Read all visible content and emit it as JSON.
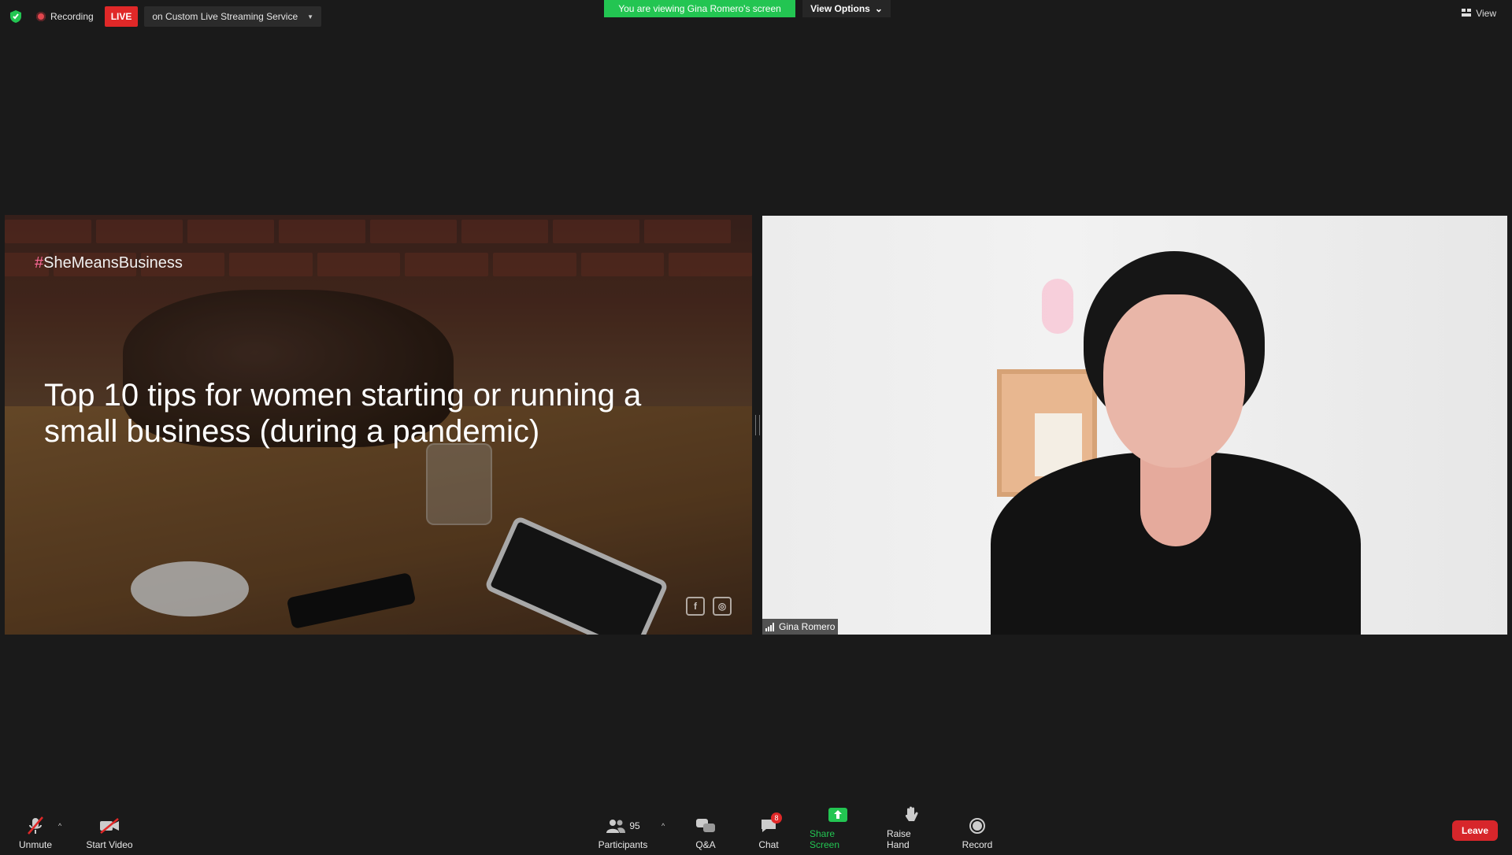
{
  "topbar": {
    "recording_label": "Recording",
    "live_label": "LIVE",
    "stream_service": "on Custom Live Streaming Service",
    "viewing_banner": "You are viewing Gina Romero's screen",
    "view_options_label": "View Options",
    "view_label": "View"
  },
  "shared_screen": {
    "hashtag_symbol": "#",
    "hashtag_text": "SheMeansBusiness",
    "title": "Top 10 tips for women starting or running a small business (during a pandemic)"
  },
  "video": {
    "participant_name": "Gina Romero"
  },
  "toolbar": {
    "unmute_label": "Unmute",
    "start_video_label": "Start Video",
    "participants_label": "Participants",
    "participants_count": "95",
    "qa_label": "Q&A",
    "chat_label": "Chat",
    "chat_badge": "8",
    "share_screen_label": "Share Screen",
    "raise_hand_label": "Raise Hand",
    "record_label": "Record",
    "leave_label": "Leave"
  },
  "colors": {
    "accent_green": "#23c552",
    "live_red": "#e02828",
    "leave_red": "#d7262b",
    "background": "#1a1a1a"
  }
}
